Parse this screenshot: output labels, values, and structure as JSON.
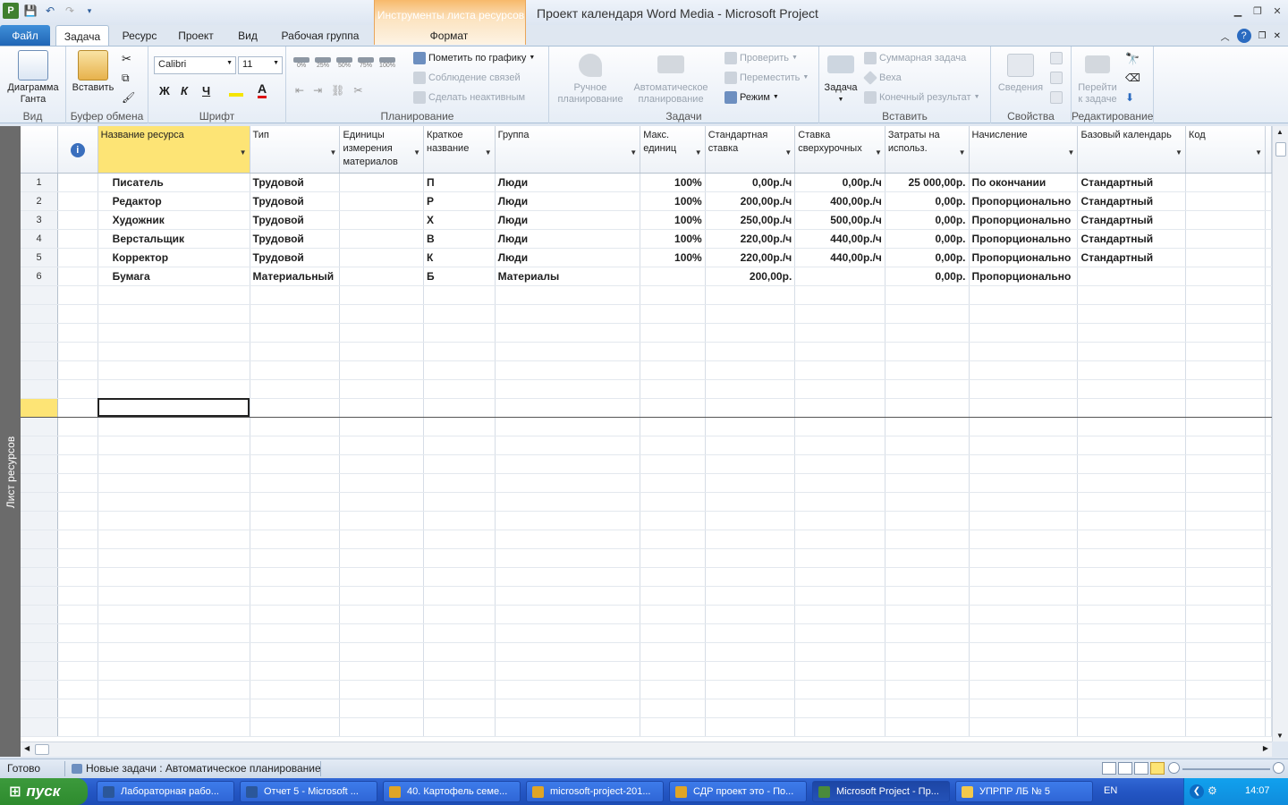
{
  "app": {
    "title": "Проект календаря Word Media  -  Microsoft Project",
    "context_tab_title": "Инструменты листа ресурсов"
  },
  "tabs": [
    "Файл",
    "Задача",
    "Ресурс",
    "Проект",
    "Вид",
    "Рабочая группа",
    "Формат"
  ],
  "ribbon": {
    "view": {
      "btn_line1": "Диаграмма",
      "btn_line2": "Ганта",
      "label": "Вид"
    },
    "clipboard": {
      "paste": "Вставить",
      "label": "Буфер обмена"
    },
    "font": {
      "family": "Calibri",
      "size": "11",
      "bold": "Ж",
      "italic": "К",
      "underline": "Ч",
      "color_letter": "А",
      "label": "Шрифт"
    },
    "schedule": {
      "pct": [
        "0%",
        "25%",
        "50%",
        "75%",
        "100%"
      ],
      "mark_on_track": "Пометить по графику",
      "respect_links": "Соблюдение связей",
      "inactivate": "Сделать неактивным",
      "label": "Планирование"
    },
    "tasks": {
      "manual1": "Ручное",
      "manual2": "планирование",
      "auto1": "Автоматическое",
      "auto2": "планирование",
      "inspect": "Проверить",
      "move": "Переместить",
      "mode": "Режим",
      "label": "Задачи"
    },
    "insert": {
      "task": "Задача",
      "summary": "Суммарная задача",
      "milestone": "Веха",
      "deliverable": "Конечный результат",
      "label": "Вставить"
    },
    "properties": {
      "info": "Сведения",
      "label": "Свойства"
    },
    "editing": {
      "scroll1": "Перейти",
      "scroll2": "к задаче",
      "label": "Редактирование"
    }
  },
  "view_bar_label": "Лист ресурсов",
  "columns": [
    {
      "id": "name",
      "label": "Название ресурса"
    },
    {
      "id": "type",
      "label": "Тип"
    },
    {
      "id": "matlabel",
      "label": "Единицы измерения материалов"
    },
    {
      "id": "initials",
      "label": "Краткое название"
    },
    {
      "id": "group",
      "label": "Группа"
    },
    {
      "id": "max",
      "label": "Макс. единиц"
    },
    {
      "id": "std",
      "label": "Стандартная ставка"
    },
    {
      "id": "ovt",
      "label": "Ставка сверхурочных"
    },
    {
      "id": "cost",
      "label": "Затраты на использ."
    },
    {
      "id": "accrue",
      "label": "Начисление"
    },
    {
      "id": "cal",
      "label": "Базовый календарь"
    },
    {
      "id": "code",
      "label": "Код"
    }
  ],
  "rows": [
    {
      "n": "1",
      "name": "Писатель",
      "type": "Трудовой",
      "matlabel": "",
      "initials": "П",
      "group": "Люди",
      "max": "100%",
      "std": "0,00р./ч",
      "ovt": "0,00р./ч",
      "cost": "25 000,00р.",
      "accrue": "По окончании",
      "cal": "Стандартный",
      "code": ""
    },
    {
      "n": "2",
      "name": "Редактор",
      "type": "Трудовой",
      "matlabel": "",
      "initials": "Р",
      "group": "Люди",
      "max": "100%",
      "std": "200,00р./ч",
      "ovt": "400,00р./ч",
      "cost": "0,00р.",
      "accrue": "Пропорционально",
      "cal": "Стандартный",
      "code": ""
    },
    {
      "n": "3",
      "name": "Художник",
      "type": "Трудовой",
      "matlabel": "",
      "initials": "Х",
      "group": "Люди",
      "max": "100%",
      "std": "250,00р./ч",
      "ovt": "500,00р./ч",
      "cost": "0,00р.",
      "accrue": "Пропорционально",
      "cal": "Стандартный",
      "code": ""
    },
    {
      "n": "4",
      "name": "Верстальщик",
      "type": "Трудовой",
      "matlabel": "",
      "initials": "В",
      "group": "Люди",
      "max": "100%",
      "std": "220,00р./ч",
      "ovt": "440,00р./ч",
      "cost": "0,00р.",
      "accrue": "Пропорционально",
      "cal": "Стандартный",
      "code": ""
    },
    {
      "n": "5",
      "name": "Корректор",
      "type": "Трудовой",
      "matlabel": "",
      "initials": "К",
      "group": "Люди",
      "max": "100%",
      "std": "220,00р./ч",
      "ovt": "440,00р./ч",
      "cost": "0,00р.",
      "accrue": "Пропорционально",
      "cal": "Стандартный",
      "code": ""
    },
    {
      "n": "6",
      "name": "Бумага",
      "type": "Материальный",
      "matlabel": "",
      "initials": "Б",
      "group": "Материалы",
      "max": "",
      "std": "200,00р.",
      "ovt": "",
      "cost": "0,00р.",
      "accrue": "Пропорционально",
      "cal": "",
      "code": ""
    }
  ],
  "status": {
    "ready": "Готово",
    "new_tasks": "Новые задачи : Автоматическое планирование"
  },
  "taskbar": {
    "start": "пуск",
    "items": [
      {
        "label": "Лабораторная рабо...",
        "color": "#2b579a"
      },
      {
        "label": "Отчет 5 - Microsoft ...",
        "color": "#2b579a"
      },
      {
        "label": "40. Картофель семе...",
        "color": "#e0a526"
      },
      {
        "label": "microsoft-project-201...",
        "color": "#e0a526"
      },
      {
        "label": "СДР проект это - По...",
        "color": "#e0a526"
      },
      {
        "label": "Microsoft Project - Пр...",
        "color": "#4a8a3c"
      },
      {
        "label": "УПРПР ЛБ № 5",
        "color": "#f2c94c"
      }
    ],
    "lang": "EN",
    "time": "14:07"
  },
  "colors": {
    "accent": "#2b6bc0",
    "selection": "#fde475",
    "file_tab": "#2a72c6"
  }
}
